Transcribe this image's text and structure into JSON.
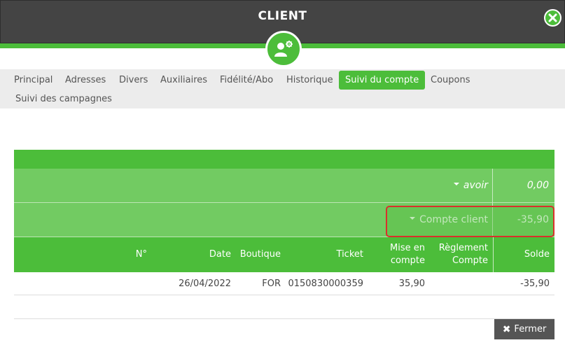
{
  "dialog": {
    "title": "CLIENT",
    "colors": {
      "accent": "#4cbd3a",
      "header": "#444444",
      "highlight_border": "#d9302c"
    }
  },
  "icons": {
    "close": "close-icon",
    "user_settings": "user-gear-icon",
    "caret": "caret-down-icon",
    "fermer": "x-icon"
  },
  "tabs": [
    {
      "label": "Principal",
      "active": false
    },
    {
      "label": "Adresses",
      "active": false
    },
    {
      "label": "Divers",
      "active": false
    },
    {
      "label": "Auxiliaires",
      "active": false
    },
    {
      "label": "Fidélité/Abo",
      "active": false
    },
    {
      "label": "Historique",
      "active": false
    },
    {
      "label": "Suivi du compte",
      "active": true
    },
    {
      "label": "Coupons",
      "active": false
    },
    {
      "label": "Suivi des campagnes",
      "active": false
    }
  ],
  "summary": {
    "avoir_label": "avoir",
    "avoir_value": "0,00",
    "compte_label": "Compte client",
    "compte_value": "-35,90"
  },
  "columns": {
    "numero": "N°",
    "date": "Date",
    "boutique": "Boutique",
    "ticket": "Ticket",
    "mise_en_compte_1": "Mise en",
    "mise_en_compte_2": "compte",
    "reglement_1": "Règlement",
    "reglement_2": "Compte",
    "solde": "Solde"
  },
  "rows": [
    {
      "numero": "",
      "date": "26/04/2022",
      "boutique": "FOR",
      "ticket": "0150830000359",
      "mise_en_compte": "35,90",
      "reglement": "",
      "solde": "-35,90"
    }
  ],
  "footer": {
    "close_label": "Fermer"
  }
}
